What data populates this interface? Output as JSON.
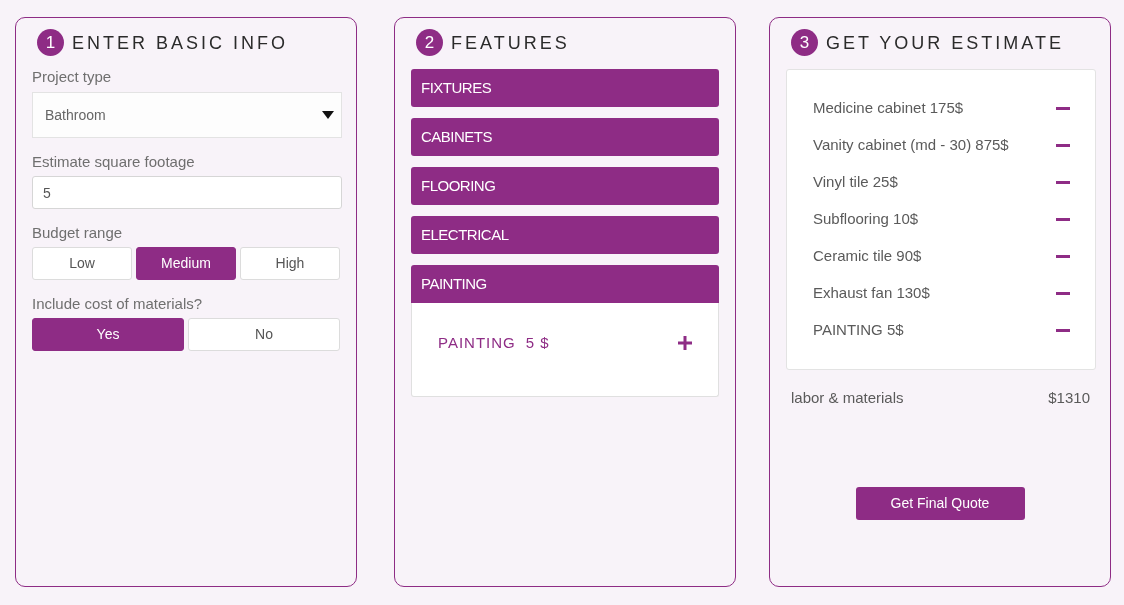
{
  "basic_info": {
    "number": "1",
    "title": "ENTER BASIC INFO",
    "project_type": {
      "label": "Project type",
      "value": "Bathroom"
    },
    "square_footage": {
      "label": "Estimate square footage",
      "value": "5"
    },
    "budget_range": {
      "label": "Budget range",
      "options": [
        {
          "label": "Low",
          "selected": false
        },
        {
          "label": "Medium",
          "selected": true
        },
        {
          "label": "High",
          "selected": false
        }
      ]
    },
    "include_materials": {
      "label": "Include cost of materials?",
      "options": [
        {
          "label": "Yes",
          "selected": true
        },
        {
          "label": "No",
          "selected": false
        }
      ]
    }
  },
  "features": {
    "number": "2",
    "title": "FEATURES",
    "sections": [
      {
        "label": "FIXTURES",
        "expanded": false
      },
      {
        "label": "CABINETS",
        "expanded": false
      },
      {
        "label": "FLOORING",
        "expanded": false
      },
      {
        "label": "ELECTRICAL",
        "expanded": false
      },
      {
        "label": "PAINTING",
        "expanded": true,
        "items": [
          {
            "name": "PAINTING",
            "price": "5 $"
          }
        ]
      }
    ]
  },
  "estimate": {
    "number": "3",
    "title": "GET YOUR ESTIMATE",
    "items": [
      "Medicine cabinet 175$",
      "Vanity cabinet (md - 30) 875$",
      "Vinyl tile 25$",
      "Subflooring 10$",
      "Ceramic tile 90$",
      "Exhaust fan 130$",
      "PAINTING 5$"
    ],
    "total": {
      "label": "labor & materials",
      "value": "$1310"
    },
    "button": "Get Final Quote"
  }
}
